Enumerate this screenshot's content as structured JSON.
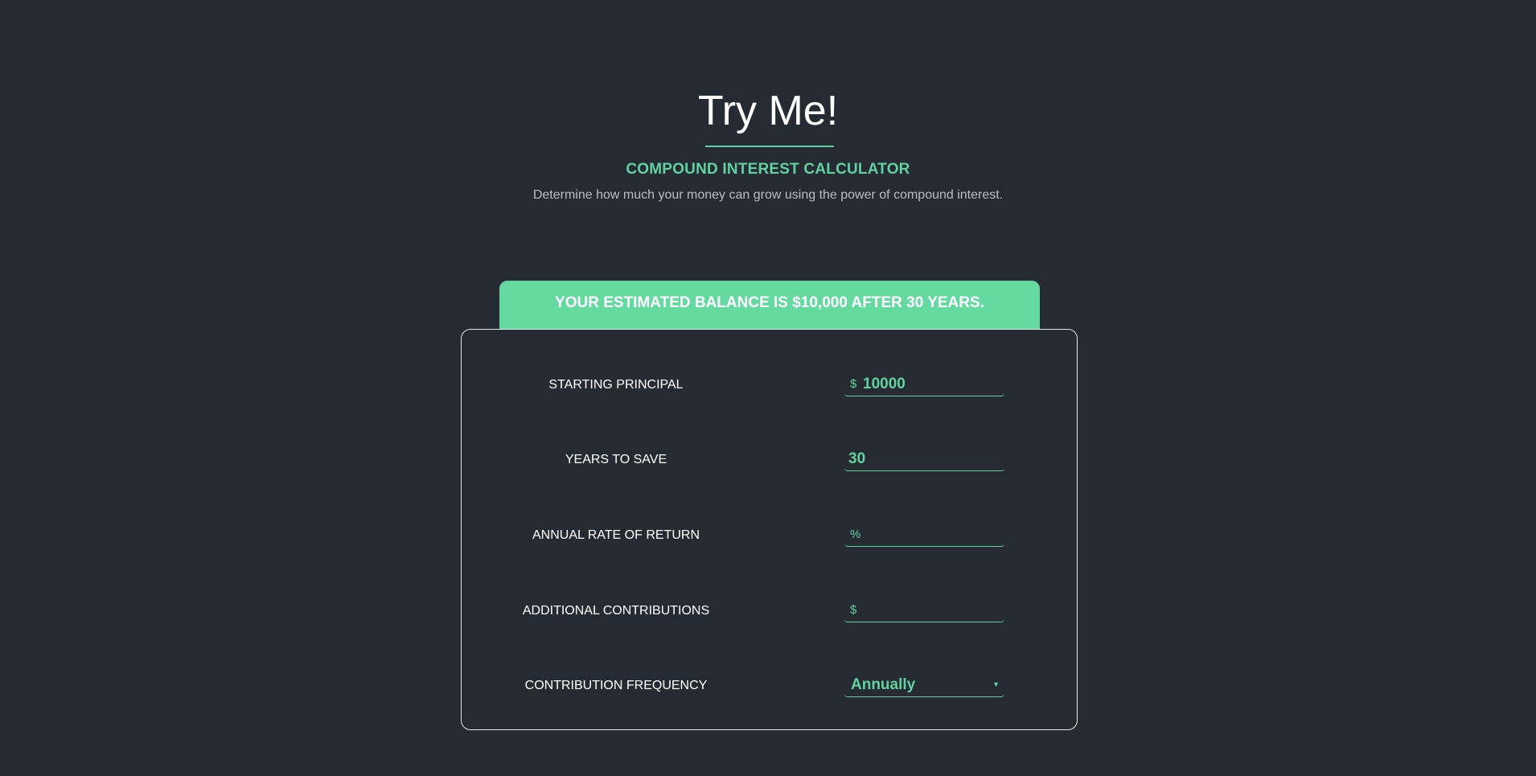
{
  "header": {
    "title": "Try Me!",
    "subtitle": "COMPOUND INTEREST CALCULATOR",
    "description": "Determine how much your money can grow using the power of compound interest."
  },
  "result": {
    "text": "YOUR ESTIMATED BALANCE IS $10,000 AFTER 30 YEARS."
  },
  "form": {
    "starting_principal": {
      "label": "STARTING PRINCIPAL",
      "prefix": "$",
      "value": "10000"
    },
    "years_to_save": {
      "label": "YEARS TO SAVE",
      "value": "30"
    },
    "annual_rate": {
      "label": "ANNUAL RATE OF RETURN",
      "prefix": "%",
      "value": ""
    },
    "additional_contributions": {
      "label": "ADDITIONAL CONTRIBUTIONS",
      "prefix": "$",
      "value": ""
    },
    "contribution_frequency": {
      "label": "CONTRIBUTION FREQUENCY",
      "selected": "Annually",
      "icon": "caret-down-icon"
    }
  },
  "colors": {
    "background": "#262b33",
    "accent": "#61d29f",
    "banner": "#64d9a0",
    "text": "#ffffff",
    "muted": "#b9bec6"
  }
}
